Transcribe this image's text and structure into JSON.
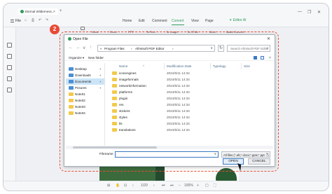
{
  "app": {
    "tab_title": "Eternal Wilderness...",
    "tab_close": "×",
    "tab_add": "+",
    "window_controls": [
      "—",
      "❐",
      "✕"
    ],
    "file_menu": "File",
    "quick_icons": [
      "save-icon",
      "print-icon",
      "undo-icon",
      "redo-icon"
    ],
    "quick_glyphs": [
      "⌂",
      "⎙",
      "↶",
      "↷"
    ],
    "menus": [
      "Home",
      "Edit",
      "Comment",
      "Convert",
      "View",
      "Page"
    ],
    "active_menu": "Convert",
    "editor_ai": "✦ Editor AI",
    "accent": "#2e9d5e"
  },
  "ribbon": [
    "Word",
    "Excel",
    "PPT",
    "To Text",
    "To Image",
    "To HTML",
    "More",
    "Batch Convert"
  ],
  "step_badge": "2",
  "dialog": {
    "title": "Open File",
    "close": "✕",
    "nav_arrows": [
      "←",
      "→",
      "∨",
      "↑"
    ],
    "breadcrumb": [
      "«",
      "Program Files",
      "›",
      "Afirstsoft PDF Editor",
      "›"
    ],
    "breadcrumb_dropdown": "∨",
    "refresh": "↻",
    "search_placeholder": "Search Afirstsoft PDF Editor",
    "search_icon": "⌕",
    "commands": {
      "organize": "Organize ▾",
      "new_folder": "New folder",
      "view_options": [
        "list-view-icon",
        "details-view-icon"
      ],
      "help": "?"
    },
    "sidebar": [
      {
        "label": "Desktop",
        "type": "blue",
        "pin": "✦"
      },
      {
        "label": "Downloads",
        "type": "blue",
        "pin": "✦"
      },
      {
        "label": "Documents",
        "type": "blue",
        "pin": "✦"
      },
      {
        "label": "Pictures",
        "type": "blue",
        "pin": "✦"
      },
      {
        "label": "Note01",
        "type": "folder",
        "pin": ""
      },
      {
        "label": "Note02",
        "type": "folder",
        "pin": ""
      },
      {
        "label": "Note03",
        "type": "folder",
        "pin": ""
      },
      {
        "label": "Note04",
        "type": "folder",
        "pin": ""
      }
    ],
    "columns": [
      "Name",
      "Modification Date",
      "Typology",
      "Size"
    ],
    "column_sort": "^",
    "files": [
      {
        "name": "iconengines",
        "date": "2024/5/11 14:34",
        "type": "folder"
      },
      {
        "name": "imageformats",
        "date": "2024/5/11 14:34",
        "type": "folder"
      },
      {
        "name": "networkinformation",
        "date": "2024/5/11 14:34",
        "type": "folder"
      },
      {
        "name": "platforms",
        "date": "2024/5/11 14:34",
        "type": "folder"
      },
      {
        "name": "plugin",
        "date": "2024/5/11 14:34",
        "type": "folder"
      },
      {
        "name": "res",
        "date": "2024/5/11 14:34",
        "type": "folder"
      },
      {
        "name": "stickers",
        "date": "2024/5/11 14:34",
        "type": "folder"
      },
      {
        "name": "styles",
        "date": "2024/5/11 14:34",
        "type": "folder"
      },
      {
        "name": "tls",
        "date": "2024/5/11 14:34",
        "type": "folder"
      },
      {
        "name": "translations",
        "date": "2024/5/11 14:34",
        "type": "folder"
      }
    ],
    "filename_label": "Filename",
    "filename_value": "",
    "filename_dropdown": "∨",
    "filter": "All files (*.afc;*.docx;*.pptx;*.ppt ...)",
    "filter_dropdown": "∨",
    "open_button": "OPEN",
    "cancel_button": "CANCEL"
  },
  "statusbar": {
    "page": "1/20",
    "zoom": "100%",
    "controls": [
      "⊞",
      "✋",
      "⊡",
      "‹",
      "›",
      "⏮",
      "⏭",
      "−",
      "+",
      "▢",
      "⛶"
    ]
  }
}
